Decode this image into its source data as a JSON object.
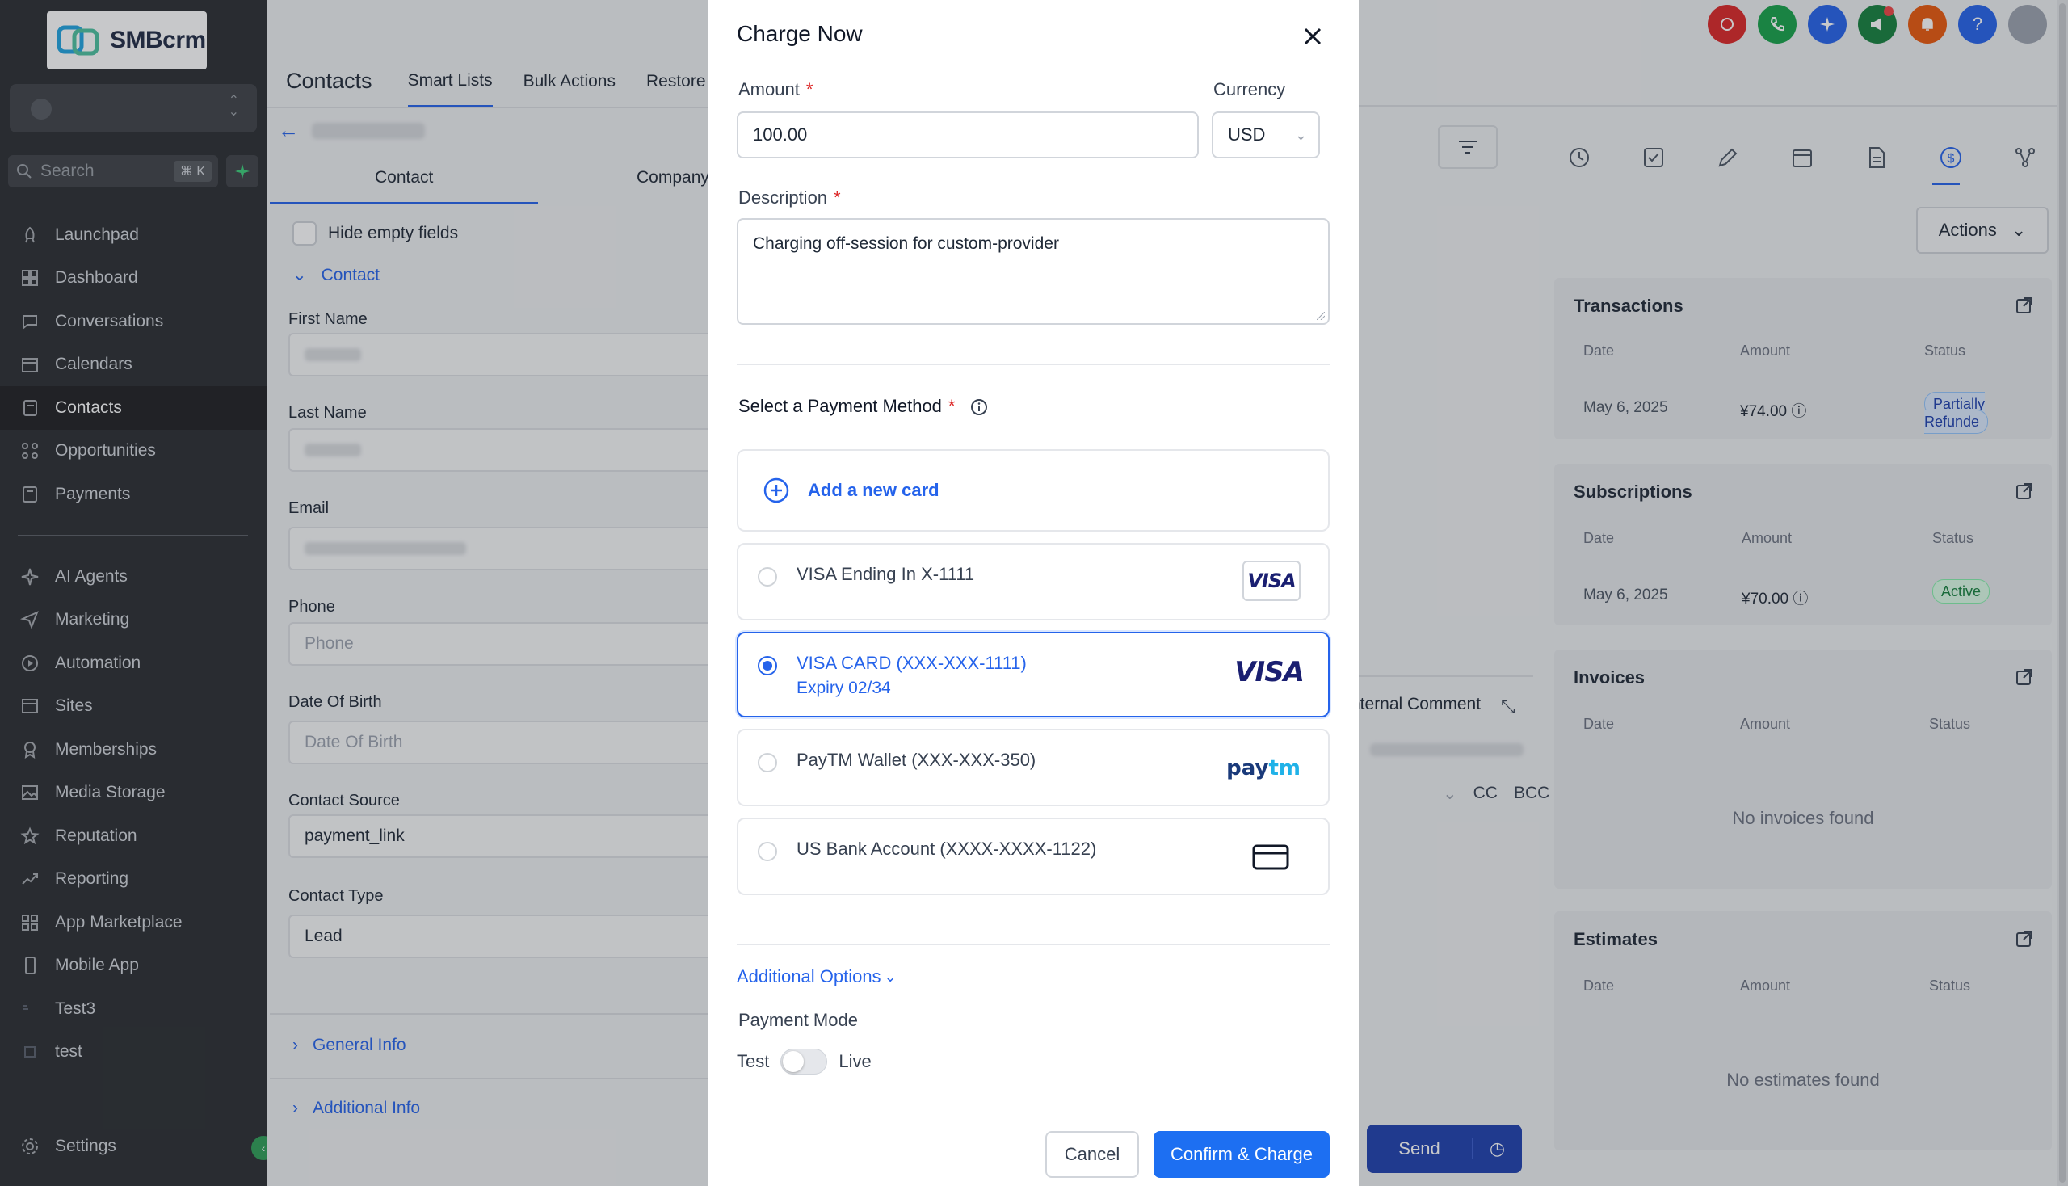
{
  "brand": {
    "name": "SMBcrm"
  },
  "search": {
    "placeholder": "Search",
    "shortcut": "⌘ K"
  },
  "sidebar": {
    "items": [
      {
        "label": "Launchpad",
        "icon": "rocket-icon"
      },
      {
        "label": "Dashboard",
        "icon": "grid-icon"
      },
      {
        "label": "Conversations",
        "icon": "chat-icon"
      },
      {
        "label": "Calendars",
        "icon": "calendar-icon"
      },
      {
        "label": "Contacts",
        "icon": "contacts-icon",
        "active": true
      },
      {
        "label": "Opportunities",
        "icon": "opportunities-icon"
      },
      {
        "label": "Payments",
        "icon": "payments-icon"
      }
    ],
    "items2": [
      {
        "label": "AI Agents",
        "icon": "sparkles-icon"
      },
      {
        "label": "Marketing",
        "icon": "send-icon"
      },
      {
        "label": "Automation",
        "icon": "automation-icon"
      },
      {
        "label": "Sites",
        "icon": "sites-icon"
      },
      {
        "label": "Memberships",
        "icon": "membership-icon"
      },
      {
        "label": "Media Storage",
        "icon": "image-icon"
      },
      {
        "label": "Reputation",
        "icon": "star-icon"
      },
      {
        "label": "Reporting",
        "icon": "trend-icon"
      },
      {
        "label": "App Marketplace",
        "icon": "apps-icon"
      },
      {
        "label": "Mobile App",
        "icon": "mobile-icon"
      },
      {
        "label": "Test3",
        "icon": "tag-icon"
      },
      {
        "label": "test",
        "icon": "square-icon"
      }
    ],
    "settings": "Settings"
  },
  "header": {
    "title": "Contacts",
    "tabs": [
      "Smart Lists",
      "Bulk Actions",
      "Restore"
    ]
  },
  "contact": {
    "tabs": [
      "Contact",
      "Company"
    ],
    "hide_empty": "Hide empty fields",
    "section": "Contact",
    "fields": {
      "first_name": "First Name",
      "last_name": "Last Name",
      "email": "Email",
      "phone": "Phone",
      "phone_placeholder": "Phone",
      "dob": "Date Of Birth",
      "dob_placeholder": "Date Of Birth",
      "source": "Contact Source",
      "source_value": "payment_link",
      "type": "Contact Type",
      "type_value": "Lead"
    },
    "general_info": "General Info",
    "additional_info": "Additional Info"
  },
  "right": {
    "actions": "Actions",
    "transactions": {
      "title": "Transactions",
      "cols": [
        "Date",
        "Amount",
        "Status"
      ],
      "row": {
        "date": "May 6, 2025",
        "amount": "¥74.00",
        "status": "Partially Refunde"
      }
    },
    "subscriptions": {
      "title": "Subscriptions",
      "cols": [
        "Date",
        "Amount",
        "Status"
      ],
      "row": {
        "date": "May 6, 2025",
        "amount": "¥70.00",
        "status": "Active"
      }
    },
    "invoices": {
      "title": "Invoices",
      "cols": [
        "Date",
        "Amount",
        "Status"
      ],
      "empty": "No invoices found"
    },
    "estimates": {
      "title": "Estimates",
      "cols": [
        "Date",
        "Amount",
        "Status"
      ],
      "empty": "No estimates found"
    }
  },
  "compose": {
    "internal_comment": "nternal Comment",
    "cc": "CC",
    "bcc": "BCC",
    "send": "Send"
  },
  "modal": {
    "title": "Charge Now",
    "amount_label": "Amount",
    "amount_value": "100.00",
    "currency_label": "Currency",
    "currency_value": "USD",
    "description_label": "Description",
    "description_value": "Charging off-session for custom-provider",
    "payment_method_label": "Select a Payment Method",
    "add_card": "Add a new card",
    "methods": [
      {
        "label": "VISA Ending In X-1111",
        "logo": "VISA"
      },
      {
        "label": "VISA CARD (XXX-XXX-1111)",
        "sub": "Expiry 02/34",
        "logo": "VISA",
        "selected": true
      },
      {
        "label": "PayTM Wallet (XXX-XXX-350)",
        "logo": "paytm"
      },
      {
        "label": "US Bank Account (XXXX-XXXX-1122)",
        "logo": "card-icon"
      }
    ],
    "additional_options": "Additional Options",
    "payment_mode": "Payment Mode",
    "mode_test": "Test",
    "mode_live": "Live",
    "cancel": "Cancel",
    "confirm": "Confirm & Charge"
  },
  "colors": {
    "accent": "#2563eb",
    "confirm": "#1d6ff2",
    "sidebar_bg": "#2a2d31",
    "required": "#dc2626"
  }
}
